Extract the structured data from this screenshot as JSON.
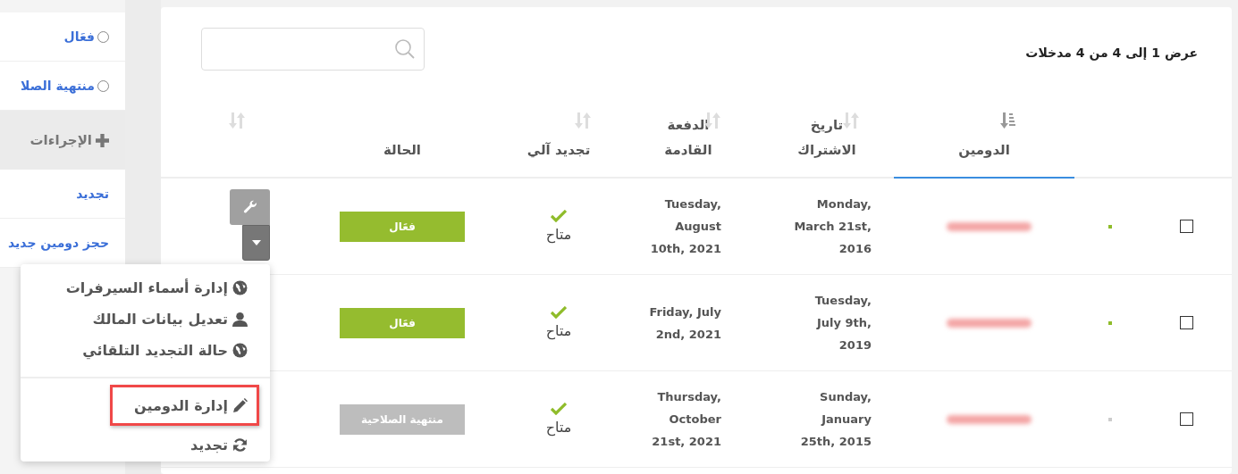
{
  "sidebar": {
    "filters": [
      {
        "label": "فعَال",
        "selected": false
      },
      {
        "label": "منتهية الصلا",
        "selected": false
      }
    ],
    "actions_header": "الإجراءات",
    "actions": [
      {
        "label": "تجديد"
      },
      {
        "label": "حجز دومين جديد"
      }
    ]
  },
  "table": {
    "info": "عرض 1 إلى 4 من 4 مدخلات",
    "columns": [
      {
        "label": "الدومين",
        "sortable": true,
        "selected": true
      },
      {
        "label": "تاريخ الاشتراك",
        "sortable": true,
        "selected": false
      },
      {
        "label": "الدفعة القادمة",
        "sortable": true,
        "selected": false
      },
      {
        "label": "تجديد آلي",
        "sortable": true,
        "selected": false
      },
      {
        "label": "الحالة",
        "sortable": false,
        "selected": false
      }
    ],
    "rows": [
      {
        "checked": false,
        "locked": true,
        "registered": "Monday, March 21st, 2016",
        "next_due": "Tuesday, August 10th, 2021",
        "auto_renew_on": true,
        "auto_renew": "متاح",
        "status": {
          "label": "فعَال",
          "kind": "active"
        }
      },
      {
        "checked": false,
        "locked": true,
        "registered": "Tuesday, July 9th, 2019",
        "next_due": "Friday, July 2nd, 2021",
        "auto_renew_on": true,
        "auto_renew": "متاح",
        "status": {
          "label": "فعَال",
          "kind": "active"
        }
      },
      {
        "checked": false,
        "locked": false,
        "registered": "Sunday, January 25th, 2015",
        "next_due": "Thursday, October 21st, 2021",
        "auto_renew_on": true,
        "auto_renew": "متاح",
        "status": {
          "label": "منتهية الصلاحية",
          "kind": "expired"
        }
      }
    ]
  },
  "menu": {
    "sections": [
      {
        "items": [
          {
            "kind": "globe",
            "label": "إدارة أسماء السيرفرات",
            "highlighted": false
          },
          {
            "kind": "user",
            "label": "تعديل بيانات المالك",
            "highlighted": false
          },
          {
            "kind": "globe",
            "label": "حالة التجديد التلقائي",
            "highlighted": false
          }
        ]
      },
      {
        "items": [
          {
            "kind": "pencil",
            "label": "إدارة الدومين",
            "highlighted": true
          },
          {
            "kind": "refresh",
            "label": "تجديد",
            "highlighted": false
          }
        ]
      }
    ]
  }
}
